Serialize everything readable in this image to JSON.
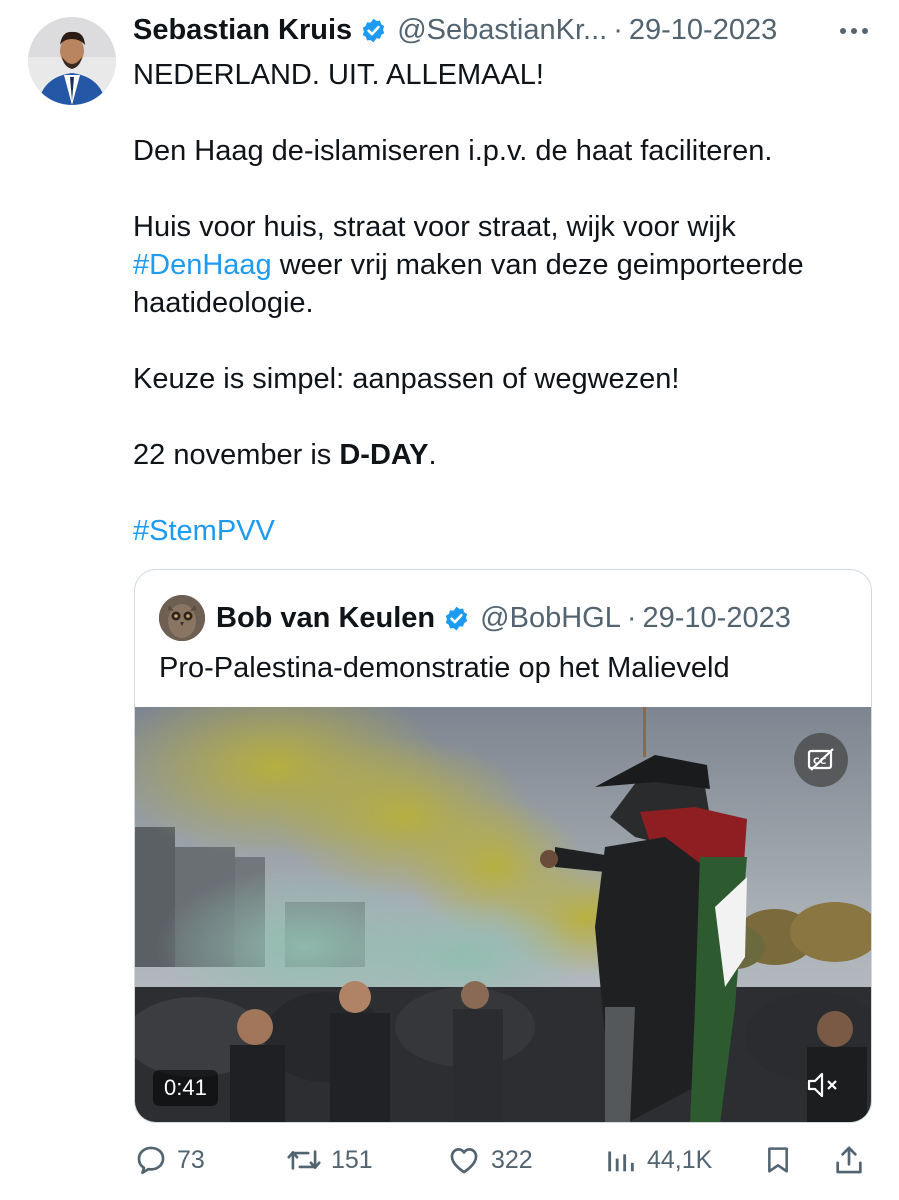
{
  "tweet": {
    "author_name": "Sebastian Kruis",
    "author_handle": "@SebastianKr...",
    "separator": "·",
    "date": "29-10-2023",
    "verified_color": "#1d9bf0",
    "paragraphs": [
      "NEDERLAND. UIT. ALLEMAAL!",
      "",
      "Den Haag de-islamiseren i.p.v. de haat faciliteren.",
      "",
      "Huis voor huis, straat voor straat, wijk voor wijk",
      "weer vrij maken van deze geimporteerde",
      "haatideologie.",
      "",
      "Keuze is simpel: aanpassen of wegwezen!",
      "",
      "22 november is",
      "D-DAY",
      ".",
      "",
      "#StemPVV"
    ],
    "hashtag_denhaag": "#DenHaag",
    "hashtag_color": "#1d9bf0"
  },
  "quote": {
    "author_name": "Bob van Keulen",
    "author_handle": "@BobHGL",
    "separator": "·",
    "date": "29-10-2023",
    "text": "Pro-Palestina-demonstratie op het Malieveld",
    "video": {
      "duration": "0:41",
      "captions_icon": "closed-captions-off-icon",
      "mute_icon": "speaker-muted-icon"
    }
  },
  "actions": {
    "replies": "73",
    "reposts": "151",
    "likes": "322",
    "views": "44,1K",
    "icons": [
      "reply-icon",
      "repost-icon",
      "like-icon",
      "views-icon",
      "bookmark-icon",
      "share-icon"
    ]
  }
}
